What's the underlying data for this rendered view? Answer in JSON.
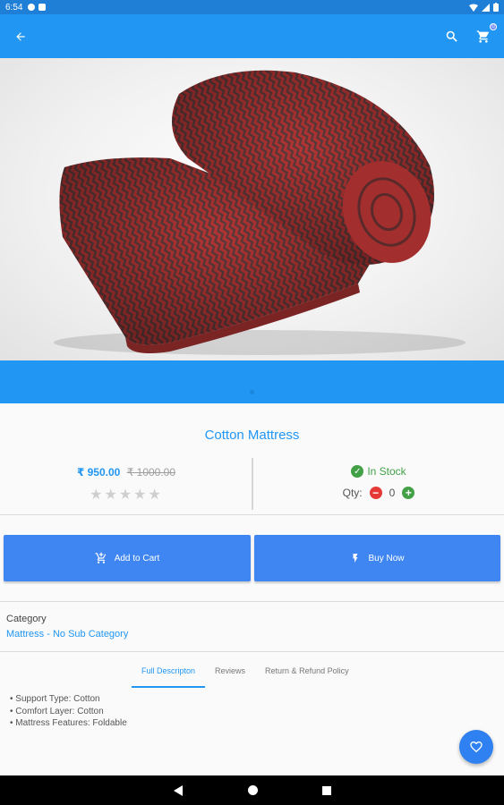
{
  "status_bar": {
    "time": "6:54"
  },
  "app_bar": {
    "cart_badge": "0"
  },
  "product": {
    "title": "Cotton Mattress",
    "price": "₹ 950.00",
    "old_price": "₹ 1000.00",
    "rating_stars": "★★★★★",
    "stock_status": "In Stock",
    "qty_label": "Qty:",
    "qty_value": "0",
    "qty_minus": "−",
    "qty_plus": "+"
  },
  "actions": {
    "add_to_cart": "Add to Cart",
    "buy_now": "Buy Now"
  },
  "category": {
    "label": "Category",
    "value": "Mattress - No Sub Category"
  },
  "tabs": [
    {
      "label": "Full Descripton"
    },
    {
      "label": "Reviews"
    },
    {
      "label": "Return & Refund Policy"
    }
  ],
  "description": [
    "• Support Type: Cotton",
    "• Comfort Layer: Cotton",
    "• Mattress Features: Foldable"
  ],
  "colors": {
    "primary": "#2196f3",
    "button": "#3f86f2",
    "in_stock": "#43a047",
    "minus": "#e53935",
    "product_red": "#b23a3a"
  },
  "icons": {
    "back": "arrow-left-icon",
    "search": "search-icon",
    "cart": "cart-icon",
    "add_cart": "cart-plus-icon",
    "buy": "lightning-icon",
    "wishlist": "heart-icon",
    "stock": "check-circle-icon"
  }
}
